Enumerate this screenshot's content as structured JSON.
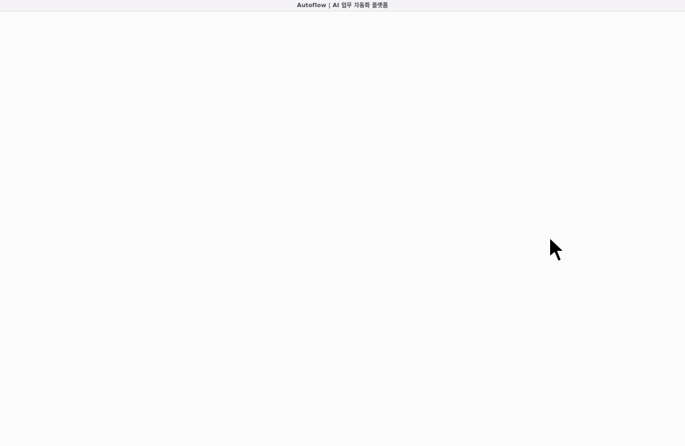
{
  "window": {
    "title": "Autoflow | AI 업무 자동화 플랫폼"
  },
  "cursor": {
    "icon": "arrow-pointer-icon"
  }
}
